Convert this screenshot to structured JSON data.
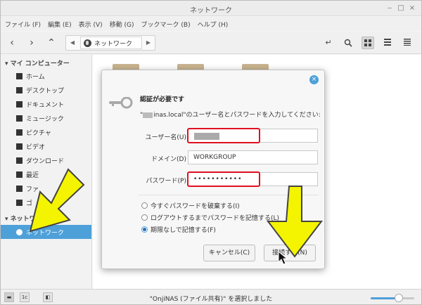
{
  "window": {
    "title": "ネットワーク",
    "controls": {
      "minimize": "‒",
      "maximize": "□",
      "close": "×"
    }
  },
  "menubar": [
    "ファイル (F)",
    "編集 (E)",
    "表示 (V)",
    "移動 (G)",
    "ブックマーク (B)",
    "ヘルプ (H)"
  ],
  "toolbar": {
    "back_icon": "chevron-left",
    "forward_icon": "chevron-right",
    "path_segment": "ネットワーク"
  },
  "sidebar": {
    "section_my_computer": "マイ コンピューター",
    "items": [
      {
        "label": "ホーム",
        "icon": "home"
      },
      {
        "label": "デスクトップ",
        "icon": "desktop"
      },
      {
        "label": "ドキュメント",
        "icon": "document"
      },
      {
        "label": "ミュージック",
        "icon": "music"
      },
      {
        "label": "ピクチャ",
        "icon": "camera"
      },
      {
        "label": "ビデオ",
        "icon": "video"
      },
      {
        "label": "ダウンロード",
        "icon": "download"
      },
      {
        "label": "最近",
        "icon": "recent"
      },
      {
        "label": "ファ",
        "icon": "filesystem"
      },
      {
        "label": "ゴ",
        "icon": "trash"
      }
    ],
    "section_network": "ネットワーク",
    "network_item": "ネットワーク"
  },
  "status": {
    "text": "\"OnjiNAS (ファイル共有)\" を選択しました",
    "zoom_level": 0.65
  },
  "dialog": {
    "title": "認証が必要です",
    "message_suffix": "inas.local\"のユーザー名とパスワードを入力してください:",
    "message_prefix": "\"",
    "username_label": "ユーザー名(U)",
    "domain_label": "ドメイン(D)",
    "domain_value": "WORKGROUP",
    "password_label": "パスワード(P)",
    "password_value": "•••••••••••",
    "options": [
      {
        "label": "今すぐパスワードを破棄する(I)",
        "selected": false
      },
      {
        "label": "ログアウトするまでパスワードを記憶する(L)",
        "selected": false
      },
      {
        "label": "期限なしで記憶する(F)",
        "selected": true
      }
    ],
    "cancel_label": "キャンセル(C)",
    "connect_label": "接続する(N)"
  },
  "colors": {
    "accent": "#4ea0d8",
    "highlight_box": "#e01020",
    "annotation_arrow": "#f4f400"
  }
}
